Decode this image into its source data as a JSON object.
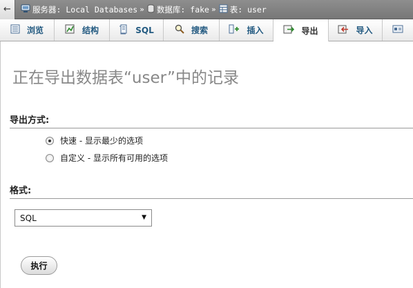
{
  "breadcrumb": {
    "back_icon": "←",
    "items": [
      {
        "icon": "server-icon",
        "label": "服务器: Local Databases"
      },
      {
        "icon": "database-icon",
        "label": "数据库: fake"
      },
      {
        "icon": "table-icon",
        "label": "表: user"
      }
    ],
    "separator": "»"
  },
  "tabs": [
    {
      "icon": "browse-icon",
      "label": "浏览"
    },
    {
      "icon": "structure-icon",
      "label": "结构"
    },
    {
      "icon": "sql-icon",
      "label": "SQL"
    },
    {
      "icon": "search-icon",
      "label": "搜索"
    },
    {
      "icon": "insert-icon",
      "label": "插入"
    },
    {
      "icon": "export-icon",
      "label": "导出",
      "active": true
    },
    {
      "icon": "import-icon",
      "label": "导入"
    },
    {
      "icon": "more-icon",
      "label": ""
    }
  ],
  "page": {
    "title": "正在导出数据表“user”中的记录",
    "export_method_heading": "导出方式:",
    "options": [
      {
        "label": "快速 - 显示最少的选项",
        "checked": true
      },
      {
        "label": "自定义 - 显示所有可用的选项",
        "checked": false
      }
    ],
    "format_heading": "格式:",
    "format_value": "SQL",
    "submit_label": "执行"
  }
}
